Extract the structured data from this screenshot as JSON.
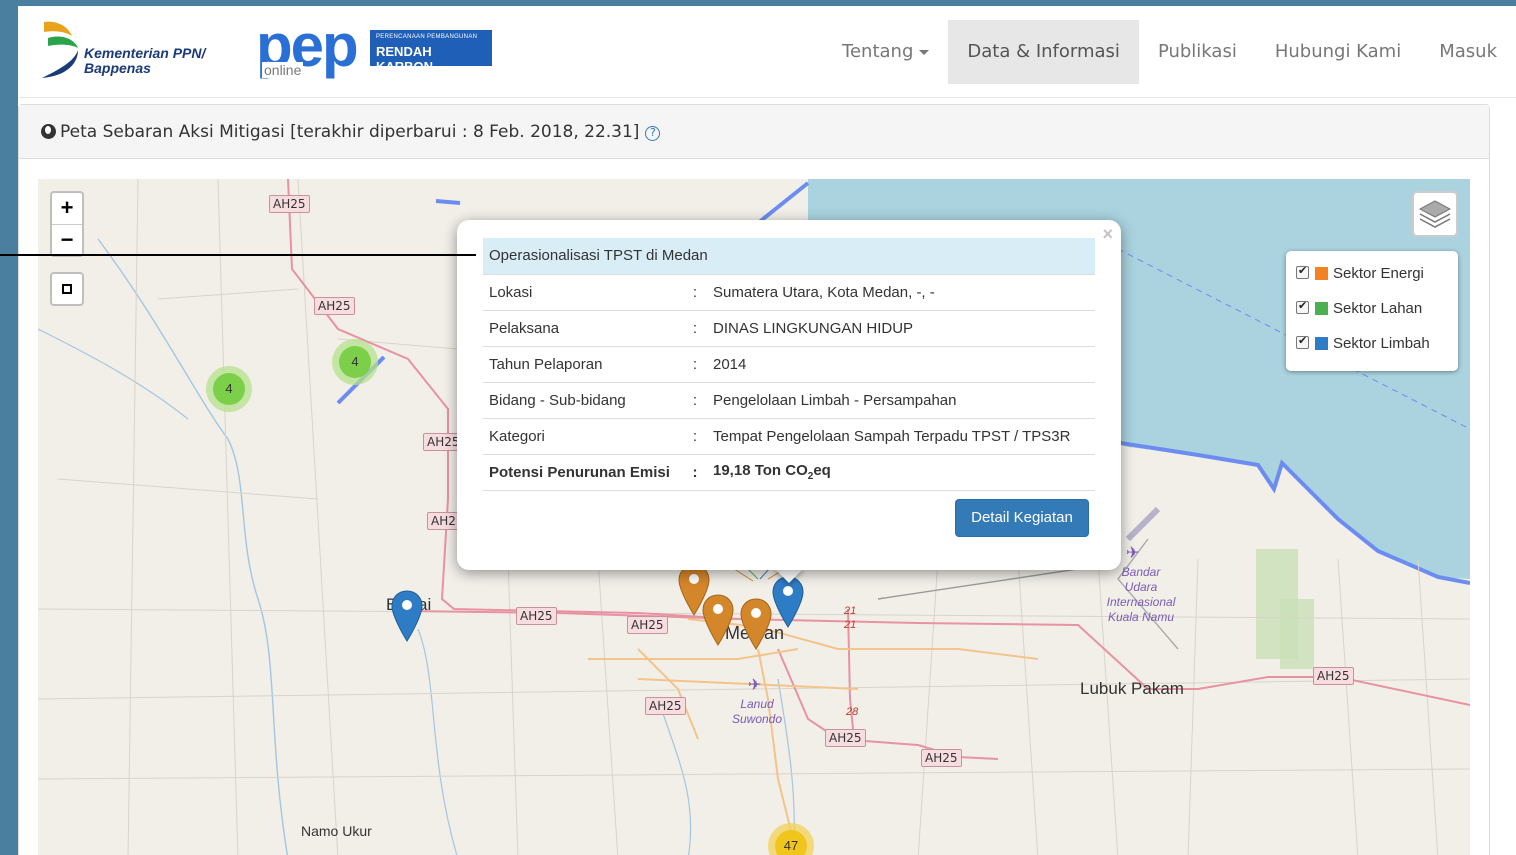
{
  "brand": {
    "kementerian_line1": "Kementerian PPN/",
    "kementerian_line2": "Bappenas",
    "pep_word": "pep",
    "pep_online": "online",
    "pep_box_small": "PERENCANAAN PEMBANGUNAN",
    "pep_box_big": "RENDAH KARBON"
  },
  "nav": {
    "items": [
      {
        "label": "Tentang",
        "dropdown": true
      },
      {
        "label": "Data & Informasi",
        "active": true
      },
      {
        "label": "Publikasi"
      },
      {
        "label": "Hubungi Kami"
      },
      {
        "label": "Masuk"
      }
    ]
  },
  "panel": {
    "title": "Peta Sebaran Aksi Mitigasi [terakhir diperbarui : 8 Feb. 2018, 22.31]",
    "help_glyph": "?"
  },
  "map": {
    "zoom_in": "+",
    "zoom_out": "−",
    "legend": [
      {
        "label": "Sektor Energi",
        "color": "#f58220",
        "checked": true
      },
      {
        "label": "Sektor Lahan",
        "color": "#4caf50",
        "checked": true
      },
      {
        "label": "Sektor Limbah",
        "color": "#2f7cc6",
        "checked": true
      }
    ],
    "labels": {
      "ah25": "AH25",
      "ah2_trunc": "AH2",
      "route_21": "21",
      "route_28": "28",
      "binjai_trunc": "B",
      "binjai_rest": "ai",
      "medan_a": "Me",
      "medan_b": "an",
      "bandar_udara": [
        "Bandar",
        "Udara",
        "Internasional",
        "Kuala Namu"
      ],
      "lanud": [
        "Lanud",
        "Suwondo"
      ],
      "lubuk_pakam": "Lubuk Pakam",
      "namo_ukur": "Namo Ukur"
    },
    "clusters": [
      {
        "count": "4"
      },
      {
        "count": "4"
      },
      {
        "count": "47"
      }
    ]
  },
  "popup": {
    "title": "Operasionalisasi TPST di Medan",
    "close": "×",
    "rows": [
      {
        "label": "Lokasi",
        "sep": ":",
        "value": "Sumatera Utara, Kota Medan, -, -"
      },
      {
        "label": "Pelaksana",
        "sep": ":",
        "value": "DINAS LINGKUNGAN HIDUP"
      },
      {
        "label": "Tahun Pelaporan",
        "sep": ":",
        "value": "2014"
      },
      {
        "label": "Bidang - Sub-bidang",
        "sep": ":",
        "value": "Pengelolaan Limbah - Persampahan"
      },
      {
        "label": "Kategori",
        "sep": ":",
        "value": "Tempat Pengelolaan Sampah Terpadu TPST / TPS3R"
      }
    ],
    "emisi_label": "Potensi Penurunan Emisi",
    "emisi_sep": ":",
    "emisi_value_prefix": "19,18 Ton CO",
    "emisi_value_sub": "2",
    "emisi_value_suffix": "eq",
    "button": "Detail Kegiatan"
  },
  "colors": {
    "energi": "#d4862a",
    "limbah": "#2f7cc6",
    "lahan_cluster": "#8fd04f"
  }
}
